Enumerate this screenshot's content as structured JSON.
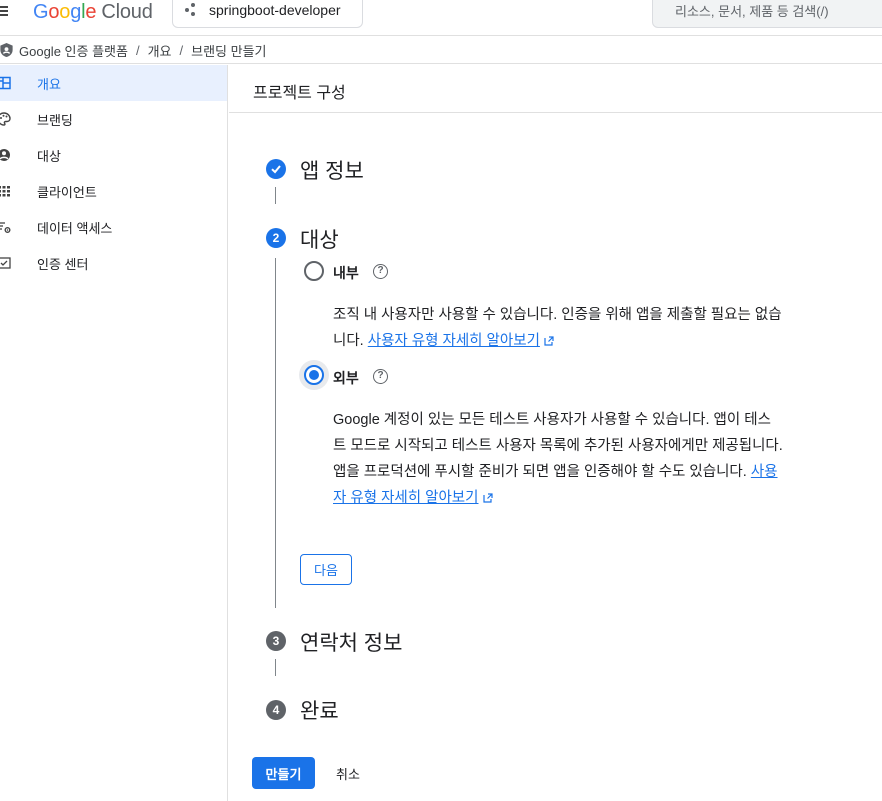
{
  "topbar": {
    "logo_google": "Google",
    "logo_cloud": "Cloud",
    "project_name": "springboot-developer",
    "search_placeholder": "리소스, 문서, 제품 등 검색(/)"
  },
  "breadcrumb": {
    "items": [
      "Google 인증 플랫폼",
      "개요",
      "브랜딩 만들기"
    ],
    "separator": "/"
  },
  "sidebar": {
    "items": [
      {
        "label": "개요",
        "icon": "dashboard-icon",
        "active": true
      },
      {
        "label": "브랜딩",
        "icon": "palette-icon",
        "active": false
      },
      {
        "label": "대상",
        "icon": "person-icon",
        "active": false
      },
      {
        "label": "클라이언트",
        "icon": "grid-icon",
        "active": false
      },
      {
        "label": "데이터 액세스",
        "icon": "data-settings-icon",
        "active": false
      },
      {
        "label": "인증 센터",
        "icon": "verified-icon",
        "active": false
      }
    ]
  },
  "main": {
    "title": "프로젝트 구성",
    "steps": [
      {
        "number": "1",
        "title": "앱 정보",
        "state": "done"
      },
      {
        "number": "2",
        "title": "대상",
        "state": "current"
      },
      {
        "number": "3",
        "title": "연락처 정보",
        "state": "pending"
      },
      {
        "number": "4",
        "title": "완료",
        "state": "pending"
      }
    ],
    "audience": {
      "internal": {
        "label": "내부",
        "desc": "조직 내 사용자만 사용할 수 있습니다. 인증을 위해 앱을 제출할 필요는 없습니다.",
        "link": "사용자 유형 자세히 알아보기"
      },
      "external": {
        "label": "외부",
        "desc": "Google 계정이 있는 모든 테스트 사용자가 사용할 수 있습니다. 앱이 테스트 모드로 시작되고 테스트 사용자 목록에 추가된 사용자에게만 제공됩니다. 앱을 프로덕션에 푸시할 준비가 되면 앱을 인증해야 할 수도 있습니다.",
        "link": "사용자 유형 자세히 알아보기"
      },
      "selected": "external"
    },
    "next_label": "다음",
    "create_label": "만들기",
    "cancel_label": "취소"
  },
  "colors": {
    "accent": "#1a73e8",
    "active_bg": "#e8f0fe",
    "pending": "#5f6368"
  }
}
